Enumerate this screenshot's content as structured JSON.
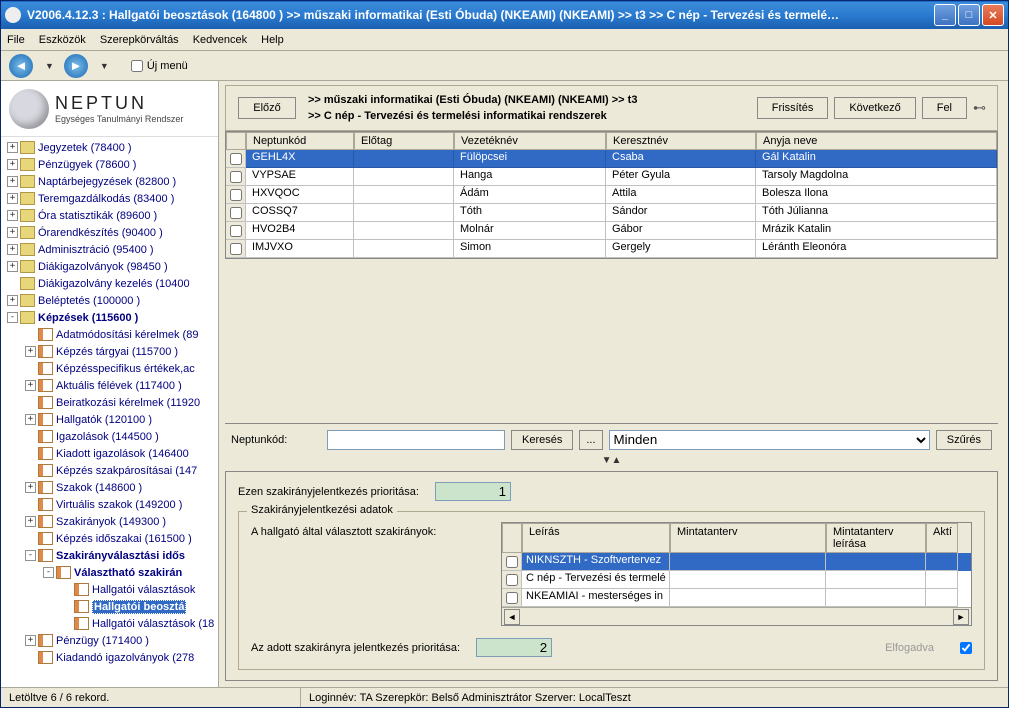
{
  "title": "V2006.4.12.3 : Hallgatói beosztások (164800  )  >> műszaki informatikai (Esti Óbuda) (NKEAMI) (NKEAMI) >> t3 >> C nép - Tervezési és termelé…",
  "menubar": [
    "File",
    "Eszközök",
    "Szerepkörváltás",
    "Kedvencek",
    "Help"
  ],
  "uj_menu": "Új menü",
  "logo": {
    "name": "NEPTUN",
    "subtitle": "Egységes Tanulmányi Rendszer"
  },
  "tree": [
    {
      "lvl": 0,
      "exp": "+",
      "icon": "fold",
      "label": "Jegyzetek (78400  )"
    },
    {
      "lvl": 0,
      "exp": "+",
      "icon": "fold",
      "label": "Pénzügyek (78600  )"
    },
    {
      "lvl": 0,
      "exp": "+",
      "icon": "fold",
      "label": "Naptárbejegyzések (82800  )"
    },
    {
      "lvl": 0,
      "exp": "+",
      "icon": "fold",
      "label": "Teremgazdálkodás (83400  )"
    },
    {
      "lvl": 0,
      "exp": "+",
      "icon": "fold",
      "label": "Óra statisztikák (89600  )"
    },
    {
      "lvl": 0,
      "exp": "+",
      "icon": "fold",
      "label": "Órarendkészítés (90400  )"
    },
    {
      "lvl": 0,
      "exp": "+",
      "icon": "fold",
      "label": "Adminisztráció (95400  )"
    },
    {
      "lvl": 0,
      "exp": "+",
      "icon": "fold",
      "label": "Diákigazolványok (98450  )"
    },
    {
      "lvl": 0,
      "exp": "",
      "icon": "fold",
      "label": "Diákigazolvány kezelés (10400"
    },
    {
      "lvl": 0,
      "exp": "+",
      "icon": "fold",
      "label": "Beléptetés (100000  )"
    },
    {
      "lvl": 0,
      "exp": "-",
      "icon": "fold",
      "label": "Képzések (115600  )",
      "bold": true
    },
    {
      "lvl": 1,
      "exp": "",
      "icon": "form",
      "label": "Adatmódosítási kérelmek (89"
    },
    {
      "lvl": 1,
      "exp": "+",
      "icon": "form",
      "label": "Képzés tárgyai (115700  )"
    },
    {
      "lvl": 1,
      "exp": "",
      "icon": "form",
      "label": "Képzésspecifikus értékek,ac"
    },
    {
      "lvl": 1,
      "exp": "+",
      "icon": "form",
      "label": "Aktuális félévek (117400  )"
    },
    {
      "lvl": 1,
      "exp": "",
      "icon": "form",
      "label": "Beiratkozási kérelmek (11920"
    },
    {
      "lvl": 1,
      "exp": "+",
      "icon": "form",
      "label": "Hallgatók (120100  )"
    },
    {
      "lvl": 1,
      "exp": "",
      "icon": "form",
      "label": "Igazolások (144500  )"
    },
    {
      "lvl": 1,
      "exp": "",
      "icon": "form",
      "label": "Kiadott igazolások (146400"
    },
    {
      "lvl": 1,
      "exp": "",
      "icon": "form",
      "label": "Képzés szakpárosításai (147"
    },
    {
      "lvl": 1,
      "exp": "+",
      "icon": "form",
      "label": "Szakok (148600  )"
    },
    {
      "lvl": 1,
      "exp": "",
      "icon": "form",
      "label": "Virtuális szakok (149200  )"
    },
    {
      "lvl": 1,
      "exp": "+",
      "icon": "form",
      "label": "Szakirányok (149300  )"
    },
    {
      "lvl": 1,
      "exp": "",
      "icon": "form",
      "label": "Képzés időszakai (161500  )"
    },
    {
      "lvl": 1,
      "exp": "-",
      "icon": "form",
      "label": "Szakirányválasztási idős",
      "bold": true
    },
    {
      "lvl": 2,
      "exp": "-",
      "icon": "form",
      "label": "Választható szakirán",
      "bold": true
    },
    {
      "lvl": 3,
      "exp": "",
      "icon": "form",
      "label": "Hallgatói választások"
    },
    {
      "lvl": 3,
      "exp": "",
      "icon": "form",
      "label": "Hallgatói beosztá",
      "bold": true,
      "sel": true
    },
    {
      "lvl": 3,
      "exp": "",
      "icon": "form",
      "label": "Hallgatói választások (18"
    },
    {
      "lvl": 1,
      "exp": "+",
      "icon": "form",
      "label": "Pénzügy (171400  )"
    },
    {
      "lvl": 1,
      "exp": "",
      "icon": "form",
      "label": "Kiadandó igazolványok (278"
    }
  ],
  "buttons": {
    "elozo": "Előző",
    "frissites": "Frissítés",
    "kovetkezo": "Következő",
    "fel": "Fel"
  },
  "breadcrumb": {
    "line1": ">>  műszaki informatikai (Esti Óbuda) (NKEAMI) (NKEAMI) >> t3",
    "line2": ">>  C nép - Tervezési és termelési informatikai rendszerek"
  },
  "grid": {
    "headers": [
      "Neptunkód",
      "Előtag",
      "Vezetéknév",
      "Keresztnév",
      "Anyja neve"
    ],
    "rows": [
      {
        "nep": "GEHL4X",
        "elo": "",
        "vez": "Fülöpcsei",
        "ker": "Csaba",
        "any": "Gál Katalin",
        "sel": true
      },
      {
        "nep": "VYPSAE",
        "elo": "",
        "vez": "Hanga",
        "ker": "Péter Gyula",
        "any": "Tarsoly Magdolna"
      },
      {
        "nep": "HXVQOC",
        "elo": "",
        "vez": "Ádám",
        "ker": "Attila",
        "any": "Bolesza Ilona"
      },
      {
        "nep": "COSSQ7",
        "elo": "",
        "vez": "Tóth",
        "ker": "Sándor",
        "any": "Tóth Júlianna"
      },
      {
        "nep": "HVO2B4",
        "elo": "",
        "vez": "Molnár",
        "ker": "Gábor",
        "any": "Mrázik Katalin"
      },
      {
        "nep": "IMJVXO",
        "elo": "",
        "vez": "Simon",
        "ker": "Gergely",
        "any": "Léránth Eleonóra"
      }
    ]
  },
  "search": {
    "label": "Neptunkód:",
    "kereses": "Keresés",
    "ell": "...",
    "dropdown": "Minden",
    "szures": "Szűrés"
  },
  "lower": {
    "pri_label": "Ezen szakirányjelentkezés prioritása:",
    "pri_value": "1",
    "fs_title": "Szakirányjelentkezési adatok",
    "fs_left_label": "A hallgató által választott szakirányok:",
    "spec_headers": [
      "Leírás",
      "Mintatanterv",
      "Mintatanterv leírása",
      "Aktí"
    ],
    "spec_rows": [
      {
        "le": "NIKNSZTH - Szoftvertervez",
        "sel": true
      },
      {
        "le": "C nép - Tervezési és termelé"
      },
      {
        "le": "NKEAMIAI - mesterséges in"
      }
    ],
    "bottom_label": "Az adott szakirányra jelentkezés prioritása:",
    "bottom_value": "2",
    "elfogadva": "Elfogadva"
  },
  "status": {
    "left": "Letöltve 6 / 6 rekord.",
    "right": "Loginnév: TA   Szerepkör: Belső Adminisztrátor   Szerver: LocalTeszt"
  }
}
